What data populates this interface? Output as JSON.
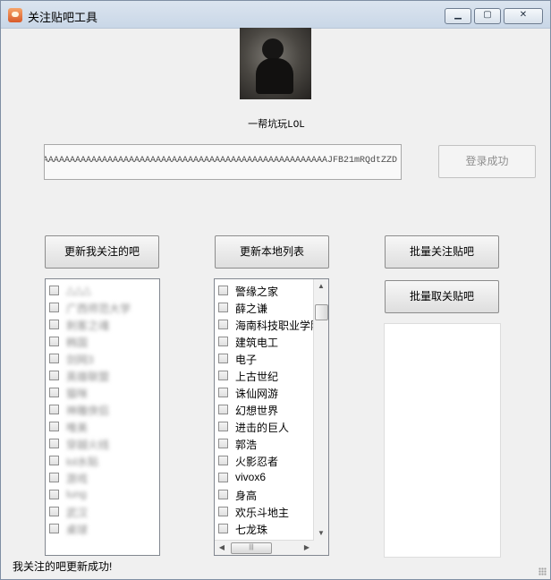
{
  "window": {
    "title": "关注贴吧工具",
    "minimize": "▁",
    "maximize": "▢",
    "close": "✕"
  },
  "user": {
    "name": "一帮坑玩LOL"
  },
  "token": {
    "value": "AAAAAAAAAAAAAAAAAAAAAAAAAAAAAAAAAAAAAAAAAAAAAAAAAAAAAAAAAAAAAAAAAAJFB21mRQdtZZD"
  },
  "buttons": {
    "login": "登录成功",
    "update_followed": "更新我关注的吧",
    "update_local": "更新本地列表",
    "batch_follow": "批量关注贴吧",
    "batch_unfollow": "批量取关贴吧"
  },
  "followed_list": {
    "items": [
      "△△△",
      "广西师范大学",
      "刺客之魂",
      "韩国",
      "剑网3",
      "英雄联盟",
      "猫咪",
      "神雕侠侣",
      "唯美",
      "穿越火线",
      "lol水贴",
      "游戏",
      "lung",
      "武汉",
      "桌球"
    ]
  },
  "local_list": {
    "items": [
      "警缘之家",
      "薛之谦",
      "海南科技职业学院",
      "建筑电工",
      "电子",
      "上古世纪",
      "诛仙网游",
      "幻想世界",
      "进击的巨人",
      "郭浩",
      "火影忍者",
      "vivox6",
      "身高",
      "欢乐斗地主",
      "七龙珠"
    ]
  },
  "scroll": {
    "up": "▲",
    "down": "▼",
    "left": "◀",
    "right": "▶",
    "grip": "|||"
  },
  "status": {
    "text": "我关注的吧更新成功!"
  },
  "colors": {
    "window_bg": "#f0f0f0",
    "titlebar": "#c9d7e7",
    "list_bg": "#ffffff",
    "disabled_text": "#8f8f8f"
  }
}
